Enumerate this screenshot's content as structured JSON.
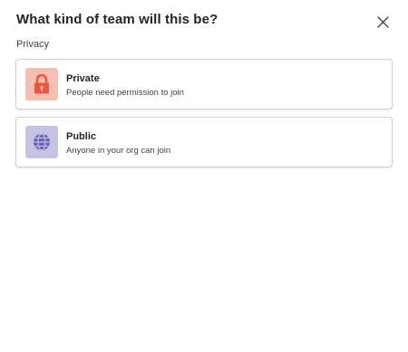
{
  "dialog": {
    "title": "What kind of team will this be?",
    "section_label": "Privacy",
    "close_icon": "close-icon"
  },
  "options": [
    {
      "title": "Private",
      "description": "People need permission to join",
      "icon": "lock-icon",
      "icon_bg_color": "#f6bfb3",
      "icon_color": "#e9573f"
    },
    {
      "title": "Public",
      "description": "Anyone in your org can join",
      "icon": "globe-icon",
      "icon_bg_color": "#c5c3e3",
      "icon_color": "#6a5fb4"
    }
  ]
}
